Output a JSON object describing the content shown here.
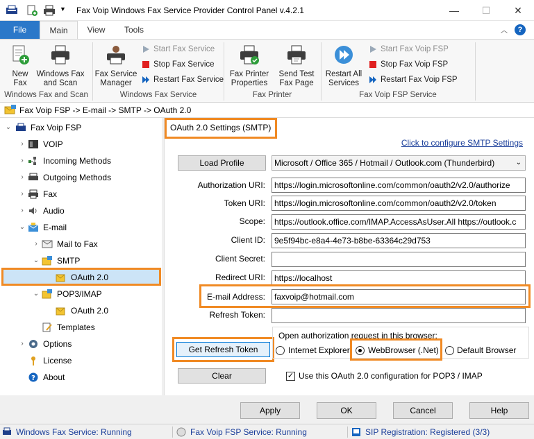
{
  "window": {
    "title": "Fax Voip Windows Fax Service Provider Control Panel v.4.2.1",
    "minimize": "—",
    "maximize": "☐",
    "close": "✕"
  },
  "tabs": {
    "file": "File",
    "main": "Main",
    "view": "View",
    "tools": "Tools",
    "help": "?"
  },
  "ribbon": {
    "windows_fax_scan": {
      "new_fax": "New\nFax",
      "wfs": "Windows Fax\nand Scan",
      "label": "Windows Fax and Scan"
    },
    "windows_fax_service": {
      "manager": "Fax Service\nManager",
      "start": "Start Fax Service",
      "stop": "Stop Fax Service",
      "restart": "Restart Fax Service",
      "label": "Windows Fax Service"
    },
    "fax_printer": {
      "properties": "Fax Printer\nProperties",
      "send_test": "Send Test\nFax Page",
      "label": "Fax Printer"
    },
    "fsp_service": {
      "restart_all": "Restart All\nServices",
      "start": "Start Fax Voip FSP",
      "stop": "Stop Fax Voip FSP",
      "restart": "Restart Fax Voip FSP",
      "label": "Fax Voip FSP Service"
    }
  },
  "breadcrumb": "Fax Voip FSP -> E-mail -> SMTP -> OAuth 2.0",
  "tree": {
    "root": "Fax Voip FSP",
    "voip": "VOIP",
    "incoming": "Incoming Methods",
    "outgoing": "Outgoing Methods",
    "fax": "Fax",
    "audio": "Audio",
    "email": "E-mail",
    "mail_to_fax": "Mail to Fax",
    "smtp": "SMTP",
    "smtp_oauth": "OAuth 2.0",
    "pop3imap": "POP3/IMAP",
    "pop_oauth": "OAuth 2.0",
    "templates": "Templates",
    "options": "Options",
    "license": "License",
    "about": "About"
  },
  "panel": {
    "title": "OAuth 2.0 Settings (SMTP)",
    "configure_link": "Click to configure SMTP Settings",
    "load_profile": "Load Profile",
    "profile_value": "Microsoft / Office 365 / Hotmail / Outlook.com (Thunderbird)",
    "auth_uri_label": "Authorization URI:",
    "auth_uri": "https://login.microsoftonline.com/common/oauth2/v2.0/authorize",
    "token_uri_label": "Token URI:",
    "token_uri": "https://login.microsoftonline.com/common/oauth2/v2.0/token",
    "scope_label": "Scope:",
    "scope": "https://outlook.office.com/IMAP.AccessAsUser.All https://outlook.c",
    "client_id_label": "Client ID:",
    "client_id": "9e5f94bc-e8a4-4e73-b8be-63364c29d753",
    "client_secret_label": "Client Secret:",
    "client_secret": "",
    "redirect_uri_label": "Redirect URI:",
    "redirect_uri": "https://localhost",
    "email_label": "E-mail Address:",
    "email": "faxvoip@hotmail.com",
    "refresh_token_label": "Refresh Token:",
    "refresh_token": "",
    "get_refresh_token": "Get Refresh Token",
    "clear": "Clear",
    "browser_group": "Open authorization request in this browser:",
    "browser_ie": "Internet Explorer",
    "browser_webbrowser": "WebBrowser (.Net)",
    "browser_default": "Default Browser",
    "use_for_pop3": "Use this OAuth 2.0 configuration for POP3 / IMAP",
    "use_for_pop3_checked": true,
    "selected_browser": "webbrowser"
  },
  "buttons": {
    "apply": "Apply",
    "ok": "OK",
    "cancel": "Cancel",
    "help": "Help"
  },
  "status": {
    "wfs": "Windows Fax Service: Running",
    "fsp": "Fax Voip FSP Service: Running",
    "sip": "SIP Registration: Registered (3/3)"
  },
  "colors": {
    "accent": "#2b78c9",
    "highlight": "#f08a24",
    "link": "#1a3e9a"
  }
}
